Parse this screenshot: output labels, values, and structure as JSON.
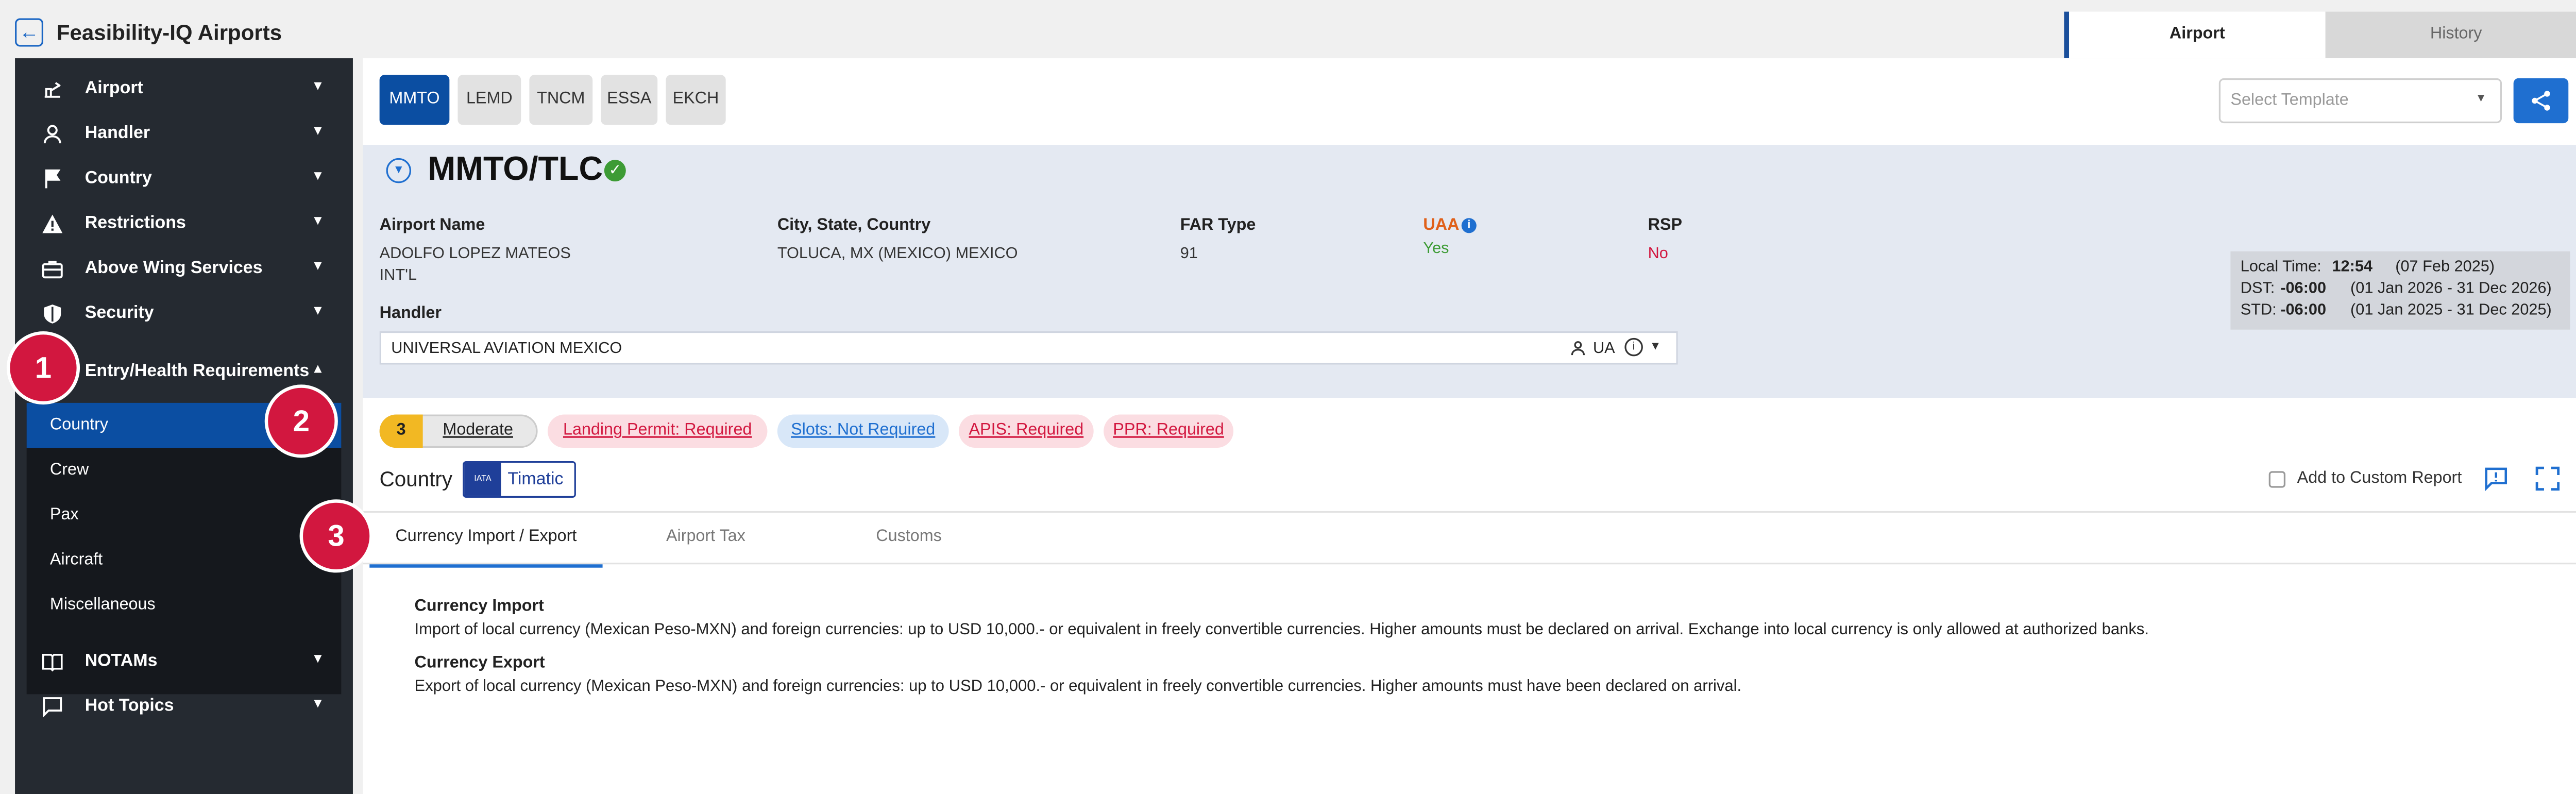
{
  "app": {
    "title": "Feasibility-IQ Airports"
  },
  "top_tabs": [
    {
      "label": "Airport",
      "active": true
    },
    {
      "label": "History",
      "active": false
    }
  ],
  "sidebar": {
    "items": [
      {
        "label": "Airport",
        "icon": "airport-icon"
      },
      {
        "label": "Handler",
        "icon": "person-icon"
      },
      {
        "label": "Country",
        "icon": "flag-icon"
      },
      {
        "label": "Restrictions",
        "icon": "warning-icon"
      },
      {
        "label": "Above Wing Services",
        "icon": "briefcase-icon"
      },
      {
        "label": "Security",
        "icon": "shield-icon"
      },
      {
        "label": "Entry/Health Requirements",
        "icon": "",
        "expanded": true
      },
      {
        "label": "NOTAMs",
        "icon": "book-icon"
      },
      {
        "label": "Hot Topics",
        "icon": "chat-icon"
      }
    ],
    "sub_items": [
      {
        "label": "Country",
        "active": true
      },
      {
        "label": "Crew",
        "active": false
      },
      {
        "label": "Pax",
        "active": false
      },
      {
        "label": "Aircraft",
        "active": false
      },
      {
        "label": "Miscellaneous",
        "active": false
      }
    ]
  },
  "step_badges": [
    "1",
    "2",
    "3"
  ],
  "airport_chips": [
    {
      "code": "MMTO",
      "active": true
    },
    {
      "code": "LEMD",
      "active": false
    },
    {
      "code": "TNCM",
      "active": false
    },
    {
      "code": "ESSA",
      "active": false
    },
    {
      "code": "EKCH",
      "active": false
    }
  ],
  "template_select": {
    "placeholder": "Select Template"
  },
  "airport": {
    "code": "MMTO/TLC",
    "fields": {
      "airport_name_label": "Airport Name",
      "airport_name_line1": "ADOLFO LOPEZ MATEOS",
      "airport_name_line2": "INT'L",
      "city_label": "City, State, Country",
      "city_value": "TOLUCA, MX (MEXICO) MEXICO",
      "far_label": "FAR Type",
      "far_value": "91",
      "uaa_label": "UAA",
      "uaa_value": "Yes",
      "rsp_label": "RSP",
      "rsp_value": "No"
    },
    "handler_label": "Handler",
    "handler_value": "UNIVERSAL AVIATION MEXICO",
    "handler_code": "UA"
  },
  "time_info": {
    "local_label": "Local Time:",
    "local_time": "12:54",
    "local_date": "(07 Feb 2025)",
    "dst_label": "DST:",
    "dst_offset": "-06:00",
    "dst_range": "(01 Jan 2026 - 31 Dec 2026)",
    "std_label": "STD:",
    "std_offset": "-06:00",
    "std_range": "(01 Jan 2025 - 31 Dec 2025)"
  },
  "risk": {
    "score": "3",
    "level": "Moderate"
  },
  "requirement_pills": [
    {
      "label": "Landing Permit: Required",
      "status": "required"
    },
    {
      "label": "Slots: Not Required",
      "status": "not-required"
    },
    {
      "label": "APIS: Required",
      "status": "required"
    },
    {
      "label": "PPR: Required",
      "status": "required"
    }
  ],
  "section": {
    "title": "Country",
    "logo_text": "Timatic",
    "logo_sub": "IATA",
    "custom_report_label": "Add to Custom Report"
  },
  "content_tabs": [
    {
      "label": "Currency Import / Export",
      "active": true
    },
    {
      "label": "Airport Tax",
      "active": false
    },
    {
      "label": "Customs",
      "active": false
    }
  ],
  "content": {
    "import_title": "Currency Import",
    "import_text": "Import of local currency (Mexican Peso-MXN) and foreign currencies: up to USD 10,000.- or equivalent in freely convertible currencies. Higher amounts must be declared on arrival. Exchange into local currency is only allowed at authorized banks.",
    "export_title": "Currency Export",
    "export_text": "Export of local currency (Mexican Peso-MXN) and foreign currencies: up to USD 10,000.- or equivalent in freely convertible currencies. Higher amounts must have been declared on arrival."
  },
  "colors": {
    "primary": "#0b4ea2",
    "sidebar": "#252a31",
    "badge": "#d2173f",
    "required": "#d2173f",
    "not_required": "#1f6fd0"
  }
}
